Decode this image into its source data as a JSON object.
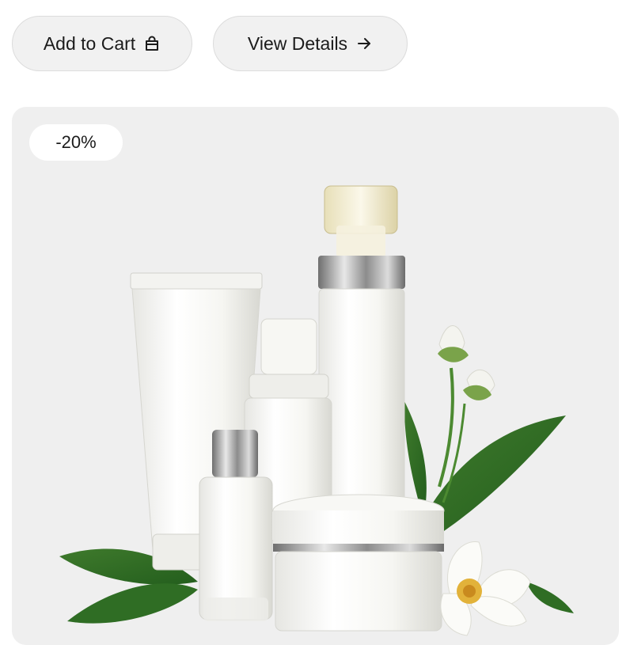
{
  "actions": {
    "add_to_cart_label": "Add to Cart",
    "add_to_cart_icon": "shopping-bag-icon",
    "view_details_label": "View Details",
    "view_details_icon": "arrow-right-icon"
  },
  "product": {
    "discount_badge": "-20%",
    "image_subject": "skincare-bottles-with-flowers"
  },
  "colors": {
    "card_background": "#efefef",
    "button_background": "#f1f1f1",
    "badge_background": "#ffffff",
    "text": "#1b1b1b"
  }
}
